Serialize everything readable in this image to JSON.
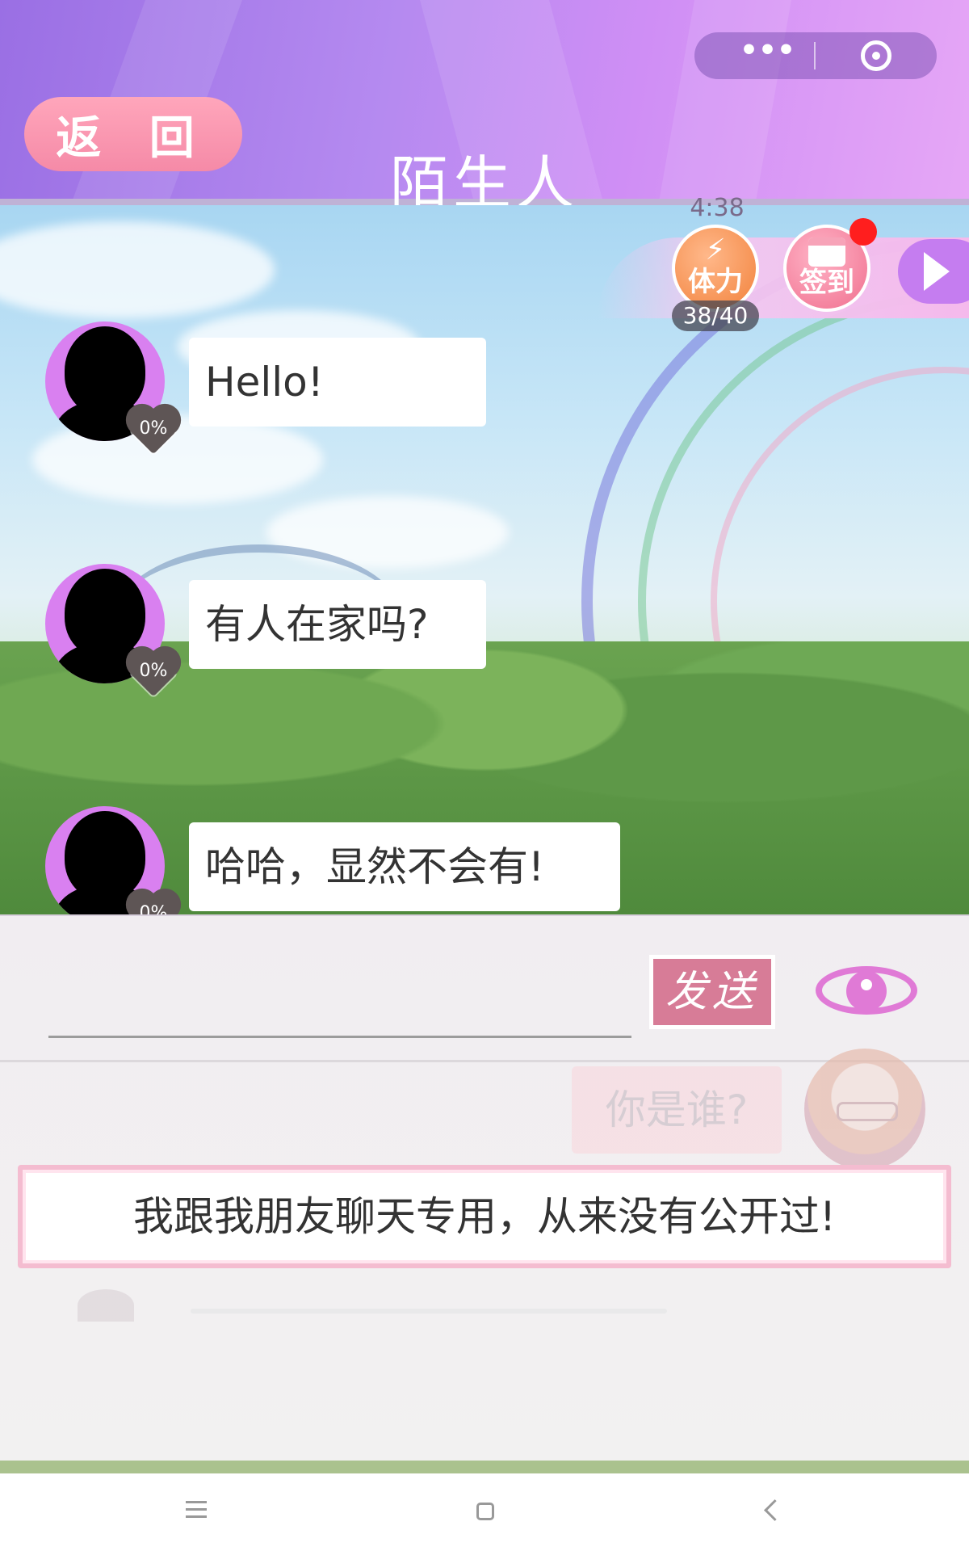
{
  "header": {
    "back_label": "返 回",
    "title": "陌生人"
  },
  "status": {
    "timer": "4:38",
    "stamina_label": "体力",
    "stamina_count": "38/40",
    "checkin_label": "签到"
  },
  "messages": [
    {
      "text": "Hello!",
      "affinity": "0%"
    },
    {
      "text": "有人在家吗?",
      "affinity": "0%"
    },
    {
      "text": "哈哈，显然不会有!",
      "affinity": "0%"
    }
  ],
  "composer": {
    "send_label": "发送"
  },
  "ghost_reply": "你是谁?",
  "reply_option": "我跟我朋友聊天专用，从来没有公开过!",
  "colors": {
    "header_purple": "#b58af0",
    "back_pink": "#f58aa7",
    "send_pink": "#d77c97",
    "eye_magenta": "#e07ad6",
    "stamina_orange": "#f2823c",
    "notification_red": "#ff1e1e"
  },
  "icons": {
    "more": "more-dots-icon",
    "close": "target-close-icon",
    "stamina": "lightning-icon",
    "checkin": "calendar-icon",
    "next": "chevron-right-icon",
    "view": "eye-icon",
    "affinity": "heart-icon"
  }
}
